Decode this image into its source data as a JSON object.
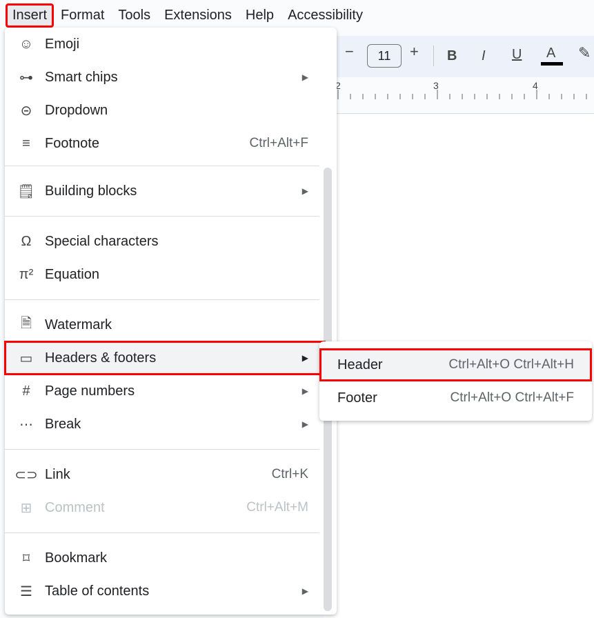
{
  "menubar": {
    "items": [
      "Insert",
      "Format",
      "Tools",
      "Extensions",
      "Help",
      "Accessibility"
    ]
  },
  "toolbar": {
    "minus": "−",
    "font_size": "11",
    "plus": "+",
    "bold": "B",
    "italic": "I",
    "underline": "U",
    "text_color": "A",
    "text_color_value": "#000000",
    "highlight_icon": "pencil-icon"
  },
  "ruler": {
    "labels": [
      "2",
      "3",
      "4"
    ]
  },
  "insert_menu": {
    "items": [
      {
        "icon": "emoji-icon",
        "glyph": "☺",
        "label": "Emoji",
        "shortcut": "",
        "submenu": false
      },
      {
        "icon": "smart-chips-icon",
        "glyph": "⊶",
        "label": "Smart chips",
        "shortcut": "",
        "submenu": true
      },
      {
        "icon": "dropdown-icon",
        "glyph": "⊝",
        "label": "Dropdown",
        "shortcut": "",
        "submenu": false
      },
      {
        "icon": "footnote-icon",
        "glyph": "≡",
        "label": "Footnote",
        "shortcut": "Ctrl+Alt+F",
        "submenu": false
      },
      {
        "icon": "building-blocks-icon",
        "glyph": "🗒",
        "label": "Building blocks",
        "shortcut": "",
        "submenu": true
      },
      {
        "icon": "omega-icon",
        "glyph": "Ω",
        "label": "Special characters",
        "shortcut": "",
        "submenu": false
      },
      {
        "icon": "pi-icon",
        "glyph": "π²",
        "label": "Equation",
        "shortcut": "",
        "submenu": false
      },
      {
        "icon": "watermark-icon",
        "glyph": "🗎",
        "label": "Watermark",
        "shortcut": "",
        "submenu": false
      },
      {
        "icon": "headers-footers-icon",
        "glyph": "▭",
        "label": "Headers & footers",
        "shortcut": "",
        "submenu": true
      },
      {
        "icon": "hash-icon",
        "glyph": "#",
        "label": "Page numbers",
        "shortcut": "",
        "submenu": true
      },
      {
        "icon": "break-icon",
        "glyph": "⋯",
        "label": "Break",
        "shortcut": "",
        "submenu": true
      },
      {
        "icon": "link-icon",
        "glyph": "⊂⊃",
        "label": "Link",
        "shortcut": "Ctrl+K",
        "submenu": false
      },
      {
        "icon": "comment-icon",
        "glyph": "⊞",
        "label": "Comment",
        "shortcut": "Ctrl+Alt+M",
        "submenu": false
      },
      {
        "icon": "bookmark-icon",
        "glyph": "⌑",
        "label": "Bookmark",
        "shortcut": "",
        "submenu": false
      },
      {
        "icon": "toc-icon",
        "glyph": "☰",
        "label": "Table of contents",
        "shortcut": "",
        "submenu": true
      }
    ],
    "submenu_arrow": "▶"
  },
  "headers_submenu": {
    "items": [
      {
        "label": "Header",
        "shortcut": "Ctrl+Alt+O Ctrl+Alt+H"
      },
      {
        "label": "Footer",
        "shortcut": "Ctrl+Alt+O Ctrl+Alt+F"
      }
    ]
  },
  "highlight_color": "#ff0000"
}
